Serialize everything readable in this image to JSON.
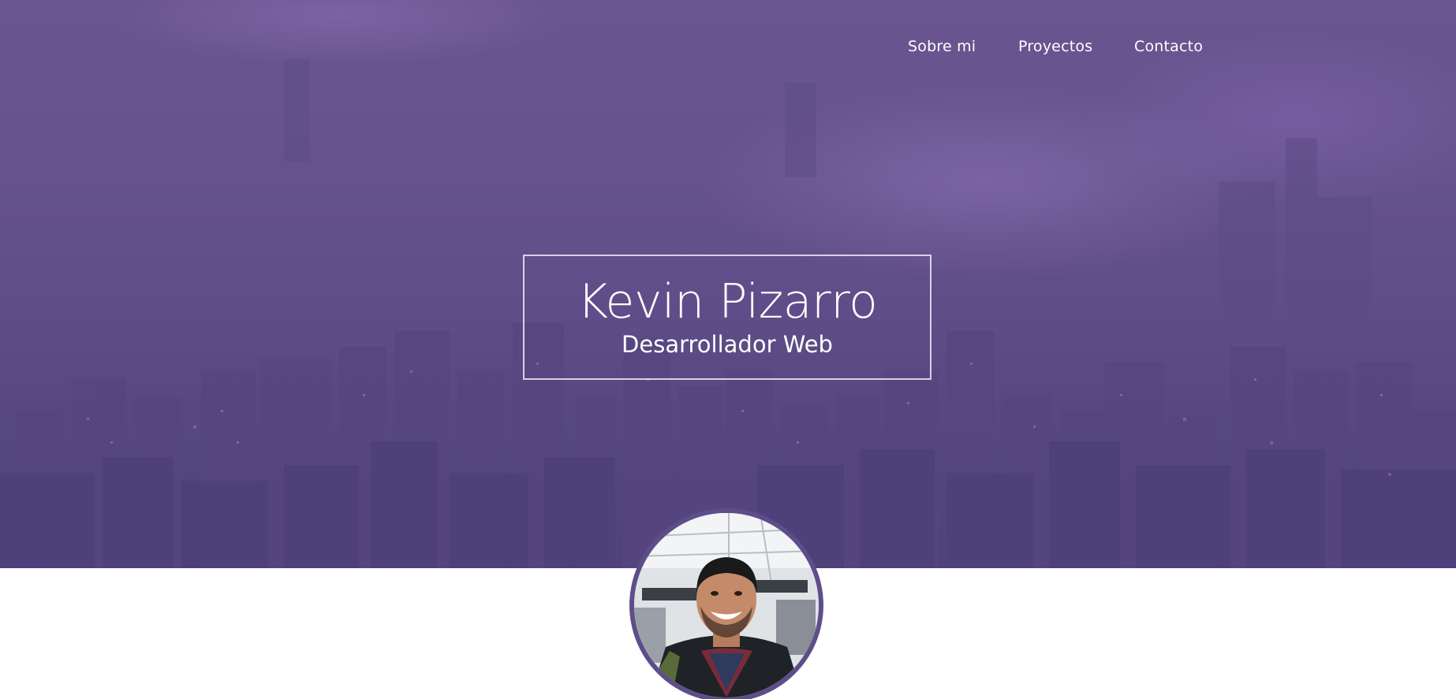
{
  "nav": {
    "items": [
      {
        "label": "Sobre mi"
      },
      {
        "label": "Proyectos"
      },
      {
        "label": "Contacto"
      }
    ]
  },
  "hero": {
    "name": "Kevin Pizarro",
    "role": "Desarrollador Web"
  },
  "colors": {
    "hero_overlay": "#5e4d88",
    "text": "#ffffff",
    "page_background": "#ffffff"
  },
  "avatar": {
    "alt": "Kevin Pizarro"
  }
}
